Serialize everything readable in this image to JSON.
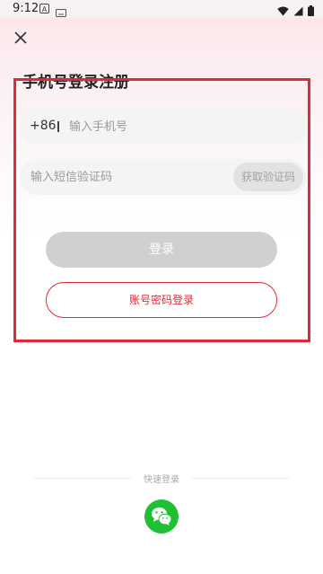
{
  "status_bar": {
    "time": "9:12",
    "app_icon_letter": "A"
  },
  "header": {
    "title": "手机号登录注册"
  },
  "phone": {
    "country_code": "+86",
    "placeholder": "输入手机号"
  },
  "code": {
    "placeholder": "输入短信验证码",
    "get_code_label": "获取验证码"
  },
  "buttons": {
    "login_label": "登录",
    "password_login_label": "账号密码登录"
  },
  "quick_login": {
    "label": "快速登录"
  },
  "colors": {
    "accent_red": "#e02a3a",
    "wechat_green": "#20c034",
    "disabled_gray": "#d0d0d0"
  }
}
